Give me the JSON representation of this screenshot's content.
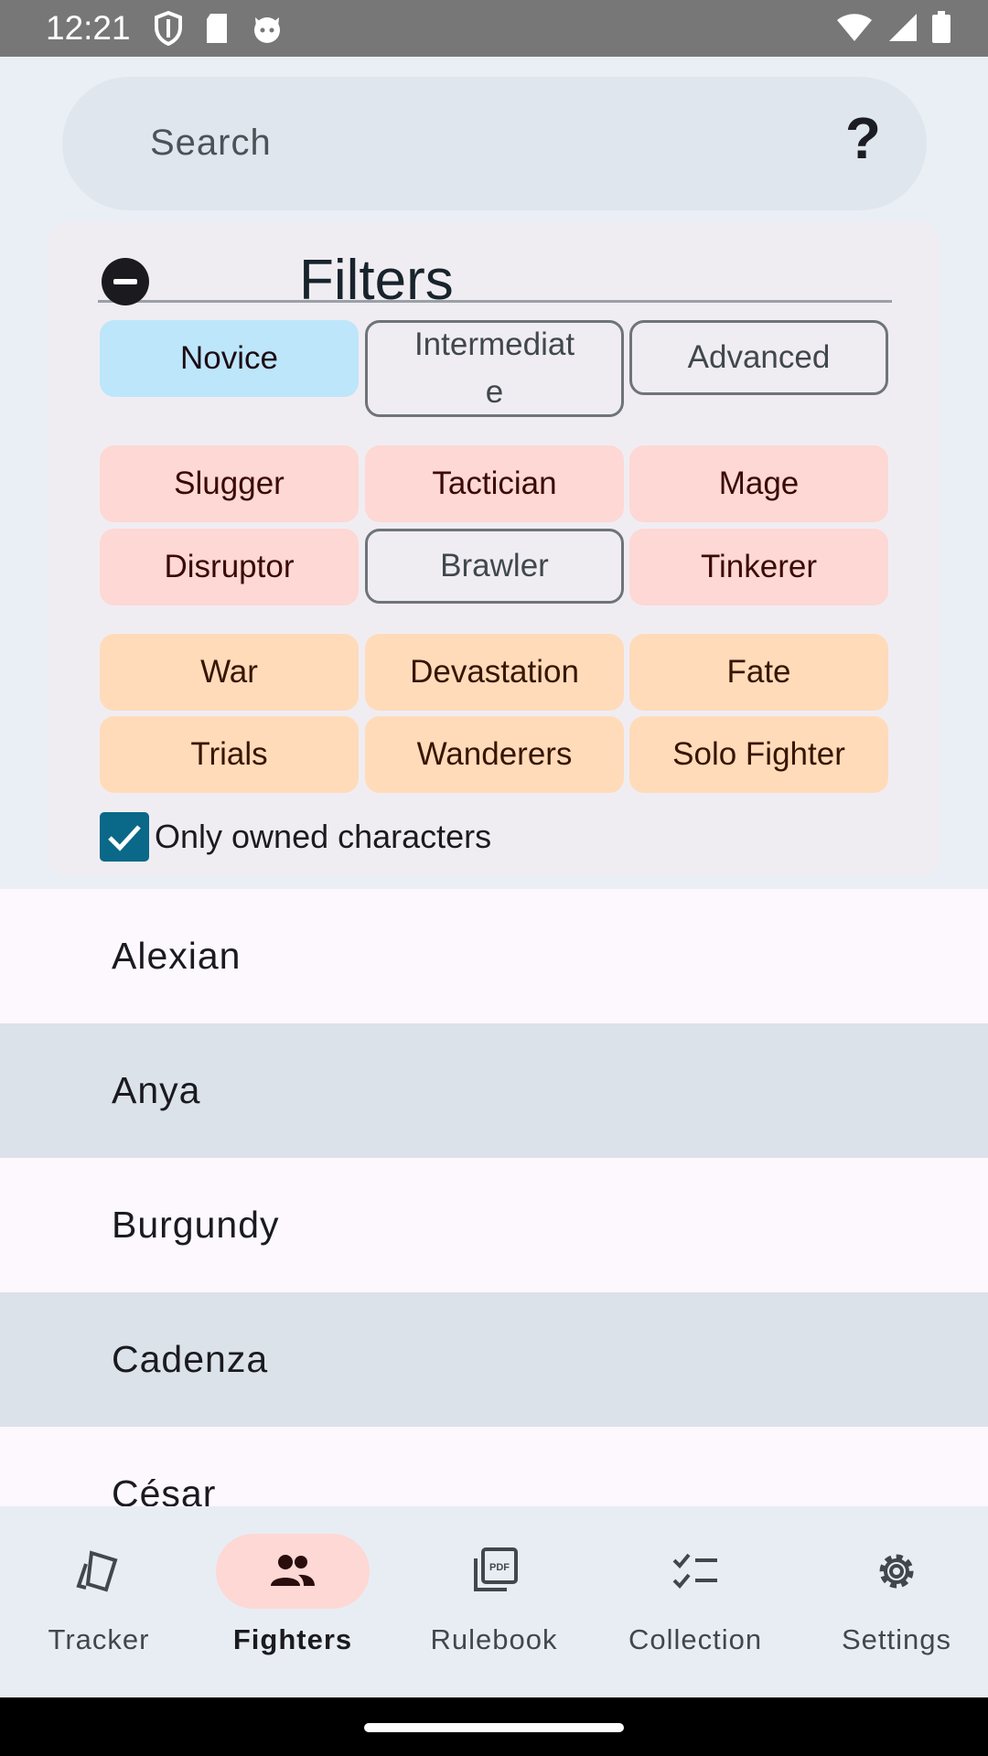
{
  "status_bar": {
    "time": "12:21"
  },
  "search": {
    "placeholder": "Search",
    "help_label": "?"
  },
  "filters": {
    "title": "Filters",
    "levels": [
      "Novice",
      "Intermediate",
      "Advanced"
    ],
    "classes": [
      "Slugger",
      "Tactician",
      "Mage",
      "Disruptor",
      "Brawler",
      "Tinkerer"
    ],
    "sets": [
      "War",
      "Devastation",
      "Fate",
      "Trials",
      "Wanderers",
      "Solo Fighter"
    ],
    "owned_only_label": "Only owned characters",
    "owned_only_checked": true,
    "selected": {
      "level": "Novice",
      "classes_off": [
        "Brawler"
      ]
    }
  },
  "fighters": [
    "Alexian",
    "Anya",
    "Burgundy",
    "Cadenza",
    "César"
  ],
  "nav": {
    "items": [
      {
        "label": "Tracker",
        "icon": "cards-icon"
      },
      {
        "label": "Fighters",
        "icon": "people-icon"
      },
      {
        "label": "Rulebook",
        "icon": "pdf-icon"
      },
      {
        "label": "Collection",
        "icon": "checklist-icon"
      },
      {
        "label": "Settings",
        "icon": "gear-icon"
      }
    ],
    "active": "Fighters"
  },
  "colors": {
    "level_selected": "#bde6fb",
    "class_chip": "#fdd8d4",
    "set_chip": "#ffdbba",
    "checkbox": "#0a6888",
    "active_nav_pill": "#fdd8d4"
  }
}
